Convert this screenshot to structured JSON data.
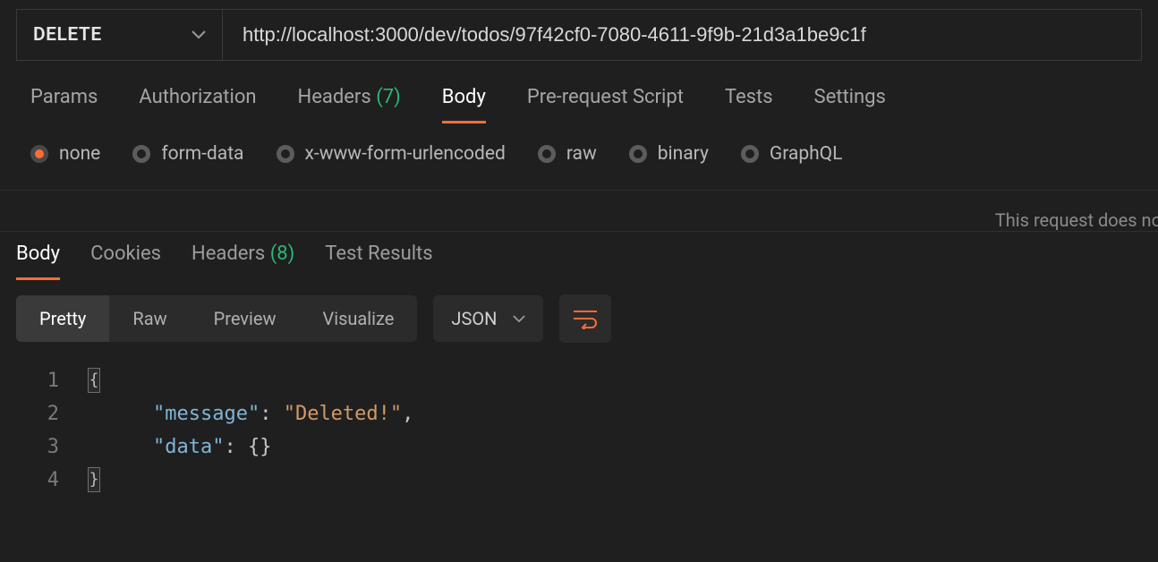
{
  "request": {
    "method": "DELETE",
    "url": "http://localhost:3000/dev/todos/97f42cf0-7080-4611-9f9b-21d3a1be9c1f",
    "tabs": {
      "params": "Params",
      "authorization": "Authorization",
      "headers_label": "Headers",
      "headers_count": "(7)",
      "body": "Body",
      "pre_request": "Pre-request Script",
      "tests": "Tests",
      "settings": "Settings"
    },
    "body_types": {
      "none": "none",
      "form_data": "form-data",
      "urlencoded": "x-www-form-urlencoded",
      "raw": "raw",
      "binary": "binary",
      "graphql": "GraphQL"
    },
    "hint": "This request does no"
  },
  "response": {
    "tabs": {
      "body": "Body",
      "cookies": "Cookies",
      "headers_label": "Headers",
      "headers_count": "(8)",
      "test_results": "Test Results"
    },
    "views": {
      "pretty": "Pretty",
      "raw": "Raw",
      "preview": "Preview",
      "visualize": "Visualize"
    },
    "format": "JSON",
    "code": {
      "line1_num": "1",
      "line1_src": "{",
      "line2_num": "2",
      "line2_indent": "    ",
      "line2_key": "\"message\"",
      "line2_sep": ": ",
      "line2_val": "\"Deleted!\"",
      "line2_end": ",",
      "line3_num": "3",
      "line3_indent": "    ",
      "line3_key": "\"data\"",
      "line3_sep": ": ",
      "line3_val": "{}",
      "line4_num": "4",
      "line4_src": "}"
    }
  }
}
